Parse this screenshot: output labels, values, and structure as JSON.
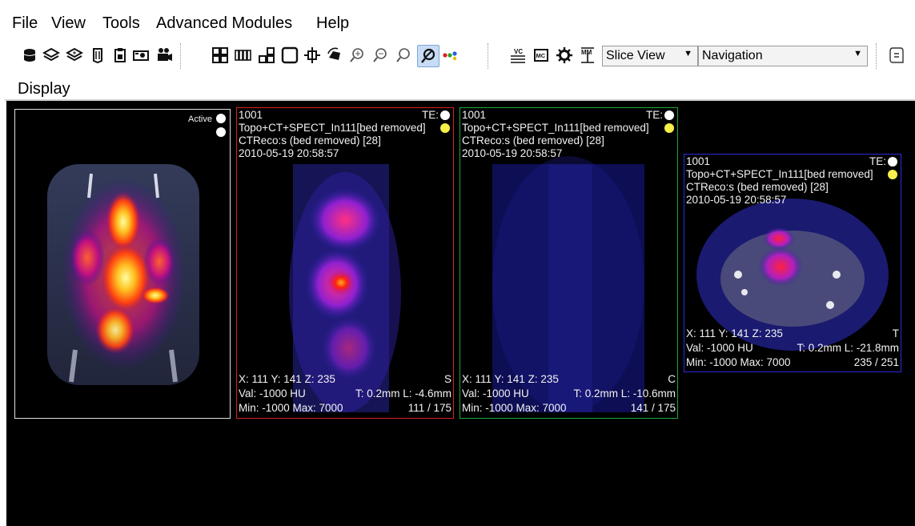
{
  "menu": [
    "File",
    "View",
    "Tools",
    "Advanced Modules",
    "Help"
  ],
  "toolbar": {
    "slice_view": "Slice View",
    "navigation": "Navigation"
  },
  "display_label": "Display",
  "render3d": {
    "active_label": "Active"
  },
  "panels": [
    {
      "id": "1001",
      "te": "TE:",
      "series": "Topo+CT+SPECT_In111[bed removed]",
      "reco": "CTReco:s (bed removed) [28]",
      "date": "2010-05-19 20:58:57",
      "coords": "X: 111 Y: 141 Z: 235",
      "orient": "S",
      "val": "Val: -1000 HU",
      "thick": "T: 0.2mm L: -4.6mm",
      "minmax": "Min: -1000 Max: 7000",
      "slice": "111 / 175",
      "border": "#d62020"
    },
    {
      "id": "1001",
      "te": "TE:",
      "series": "Topo+CT+SPECT_In111[bed removed]",
      "reco": "CTReco:s (bed removed) [28]",
      "date": "2010-05-19 20:58:57",
      "coords": "X: 111 Y: 141 Z: 235",
      "orient": "C",
      "val": "Val: -1000 HU",
      "thick": "T: 0.2mm L: -10.6mm",
      "minmax": "Min: -1000 Max: 7000",
      "slice": "141 / 175",
      "border": "#1fa63a"
    },
    {
      "id": "1001",
      "te": "TE:",
      "series": "Topo+CT+SPECT_In111[bed removed]",
      "reco": "CTReco:s (bed removed) [28]",
      "date": "2010-05-19 20:58:57",
      "coords": "X: 111 Y: 141 Z: 235",
      "orient": "T",
      "val": "Val: -1000 HU",
      "thick": "T: 0.2mm L: -21.8mm",
      "minmax": "Min: -1000 Max: 7000",
      "slice": "235 / 251",
      "border": "#2b2bd6"
    }
  ],
  "colors": {
    "sagittal_border": "#d62020",
    "coronal_border": "#1fa63a",
    "transverse_border": "#2b2bd6",
    "te_dot_white": "#ffffff",
    "te_dot_yellow": "#f5f04a",
    "active_button": "#c7dcf5"
  }
}
